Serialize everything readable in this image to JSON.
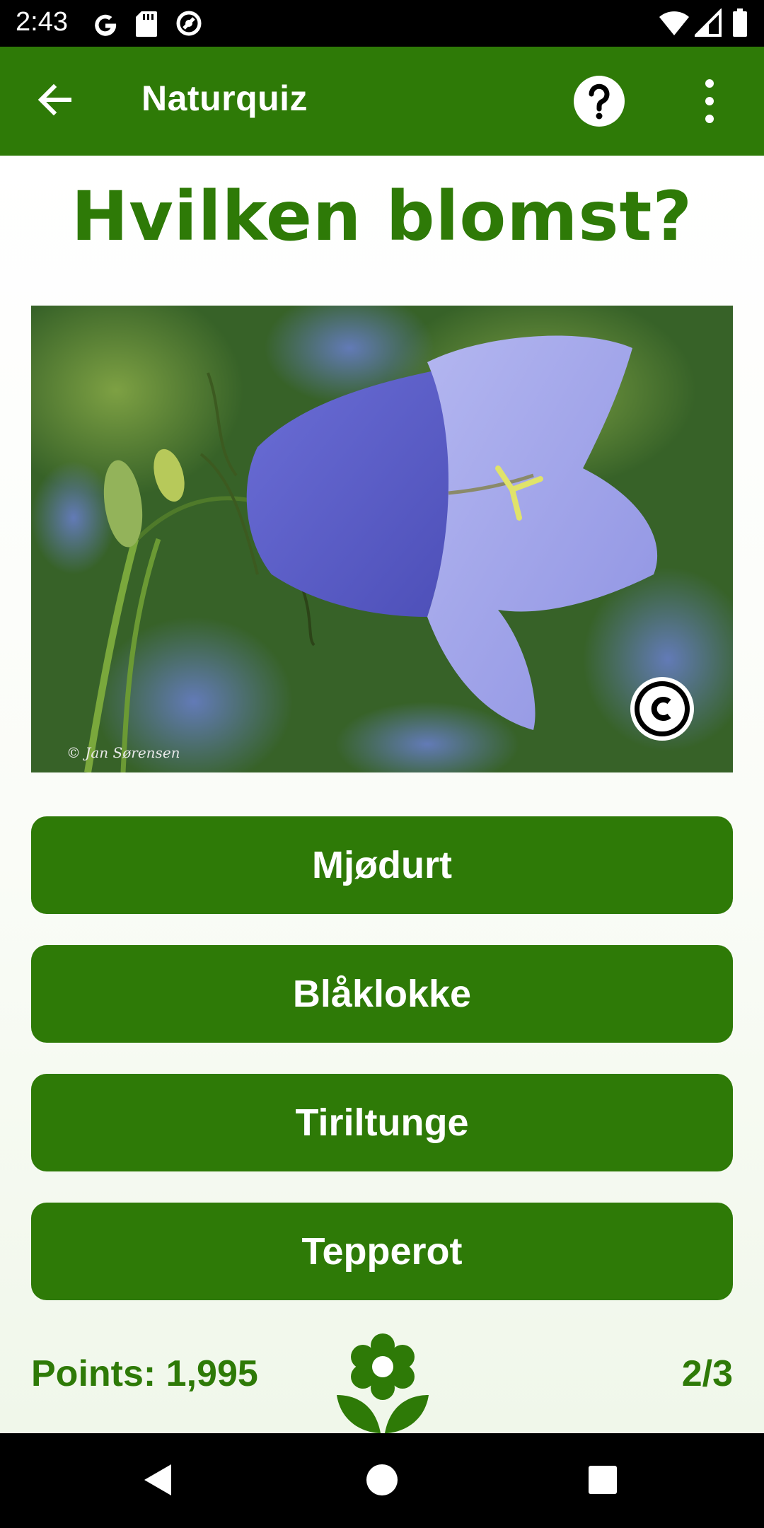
{
  "status_bar": {
    "time": "2:43",
    "icons": [
      "google-icon",
      "sd-card-icon",
      "data-saver-icon",
      "wifi-icon",
      "signal-icon",
      "battery-icon"
    ]
  },
  "app_bar": {
    "title": "Naturquiz",
    "icons": [
      "back-arrow-icon",
      "help-icon",
      "more-vert-icon"
    ]
  },
  "quiz": {
    "question": "Hvilken blomst?",
    "photo": {
      "subject": "purple bellflower",
      "credit": "© Jan Sørensen",
      "copyright_icon": "copyright-icon"
    },
    "answers": [
      {
        "label": "Mjødurt"
      },
      {
        "label": "Blåklokke"
      },
      {
        "label": "Tiriltunge"
      },
      {
        "label": "Tepperot"
      }
    ]
  },
  "footer": {
    "points": "Points: 1,995",
    "progress": "2/3",
    "logo_icon": "flower-icon"
  },
  "nav_bar": {
    "icons": [
      "back-triangle-icon",
      "home-circle-icon",
      "recents-square-icon"
    ]
  },
  "colors": {
    "primary": "#2e7a07",
    "on_primary": "#ffffff",
    "background": "#ffffff",
    "system_bars": "#000000"
  }
}
